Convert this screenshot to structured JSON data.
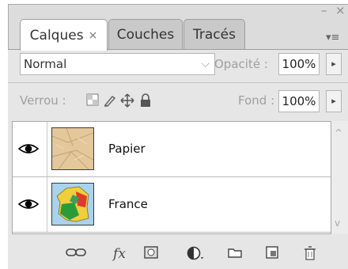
{
  "window": {
    "minimize_icon": "minimize-icon",
    "close_icon": "close-icon",
    "minimize_glyph": "–",
    "close_glyph": "×"
  },
  "tabs": [
    {
      "label": "Calques",
      "active": true,
      "close": "×"
    },
    {
      "label": "Couches",
      "active": false
    },
    {
      "label": "Tracés",
      "active": false
    }
  ],
  "panel_menu_glyph": "▾≡",
  "blend": {
    "mode": "Normal",
    "arrow": "⌵",
    "opacity_label": "Opacité :",
    "opacity_value": "100%",
    "stepper_glyph": "▸"
  },
  "lock": {
    "label": "Verrou :",
    "fill_label": "Fond :",
    "fill_value": "100%",
    "stepper_glyph": "▸",
    "icons": [
      "lock-transparent-icon",
      "lock-image-icon",
      "lock-position-icon",
      "lock-all-icon"
    ]
  },
  "layers": [
    {
      "name": "Papier",
      "visible": true,
      "thumbnail": "paper-texture"
    },
    {
      "name": "France",
      "visible": true,
      "thumbnail": "france-map"
    }
  ],
  "scroll": {
    "up": "^",
    "down": "v"
  },
  "toolbar": {
    "icons": [
      "link-layers-icon",
      "layer-style-icon",
      "layer-mask-icon",
      "adjustment-layer-icon",
      "new-group-icon",
      "new-layer-icon",
      "delete-layer-icon"
    ],
    "fx_label": "fx"
  },
  "colors": {
    "panel_bg": "#e6e6e6",
    "tab_active": "#ffffff",
    "tab_inactive": "#c9c9c9",
    "border": "#9d9d9d"
  }
}
